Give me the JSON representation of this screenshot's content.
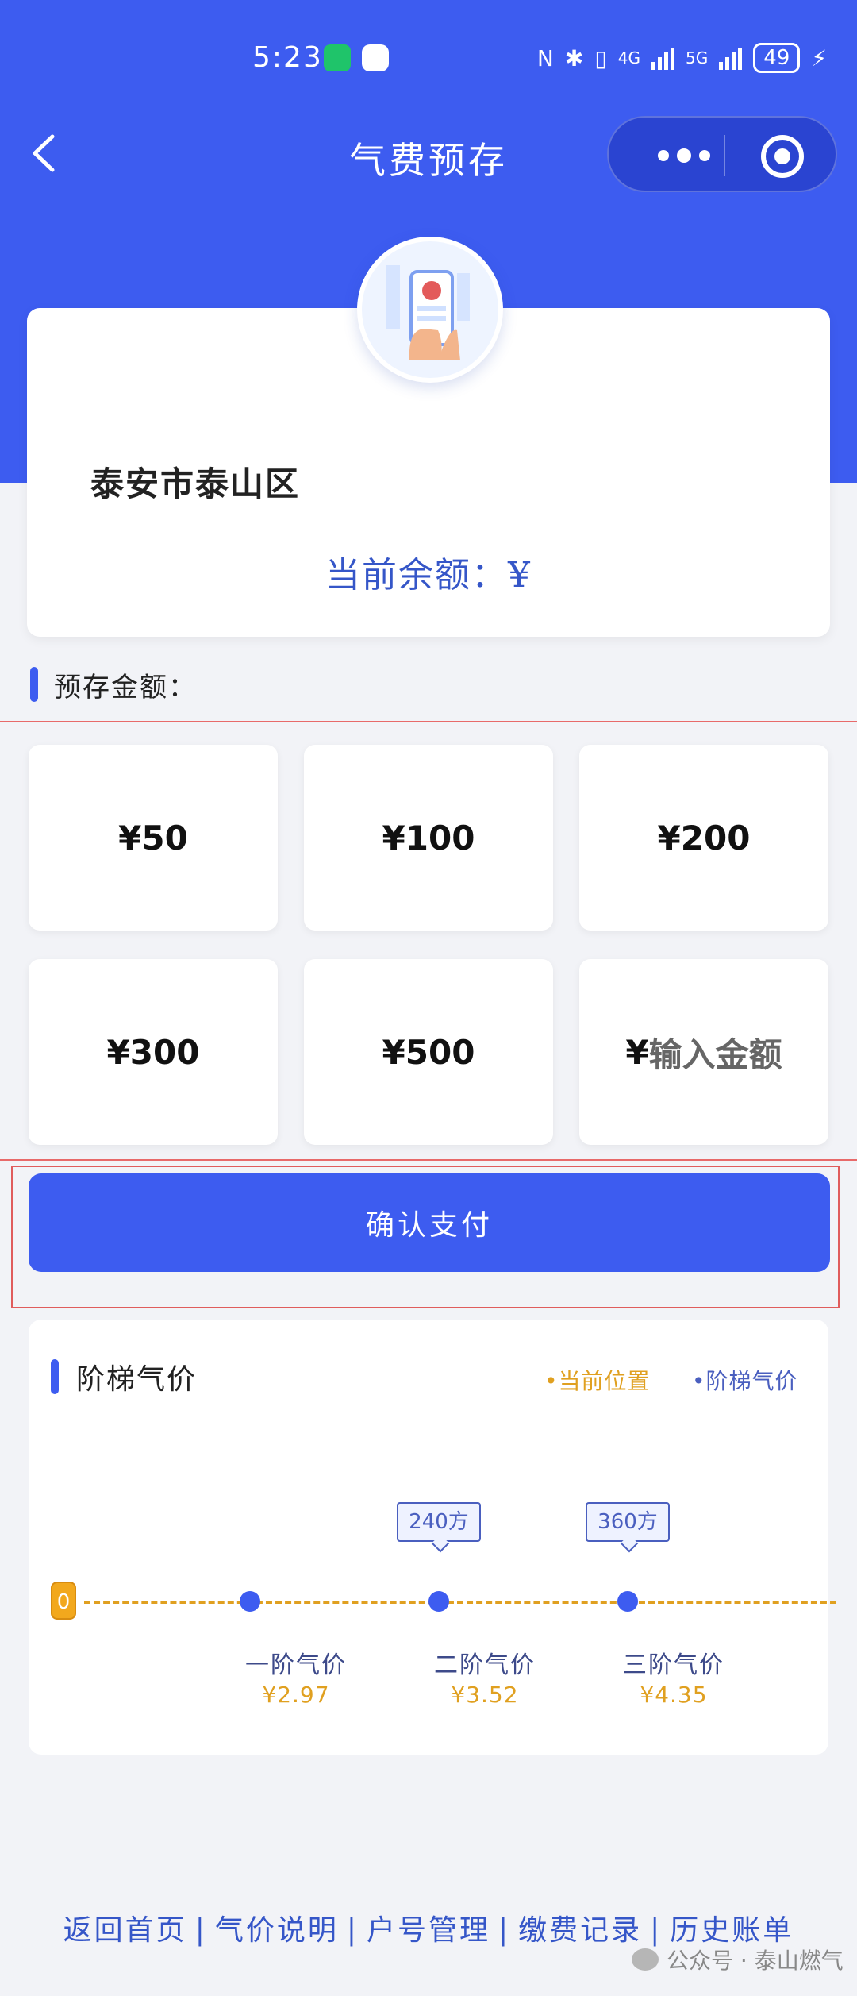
{
  "status_bar": {
    "time": "5:23",
    "network": "4G",
    "network2": "5G",
    "battery": "49"
  },
  "nav": {
    "title": "气费预存"
  },
  "account": {
    "address": "泰安市泰山区",
    "balance_label": "当前余额：¥"
  },
  "prestore": {
    "heading": "预存金额：",
    "amounts": [
      "¥50",
      "¥100",
      "¥200",
      "¥300",
      "¥500"
    ],
    "custom_prefix": "¥",
    "custom_placeholder": "输入金额"
  },
  "confirm_button": "确认支付",
  "tiers": {
    "heading": "阶梯气价",
    "legend_current": "•当前位置",
    "legend_tier": "•阶梯气价",
    "current_value": "0",
    "thresholds": [
      "240方",
      "360方"
    ],
    "items": [
      {
        "label": "一阶气价",
        "price": "¥2.97"
      },
      {
        "label": "二阶气价",
        "price": "¥3.52"
      },
      {
        "label": "三阶气价",
        "price": "¥4.35"
      }
    ]
  },
  "footer": {
    "links": [
      "返回首页",
      "气价说明",
      "户号管理",
      "缴费记录",
      "历史账单"
    ]
  },
  "watermark": "公众号 · 泰山燃气",
  "colors": {
    "primary": "#3d5cf0",
    "accent": "#e0a020",
    "background": "#f2f3f7"
  }
}
